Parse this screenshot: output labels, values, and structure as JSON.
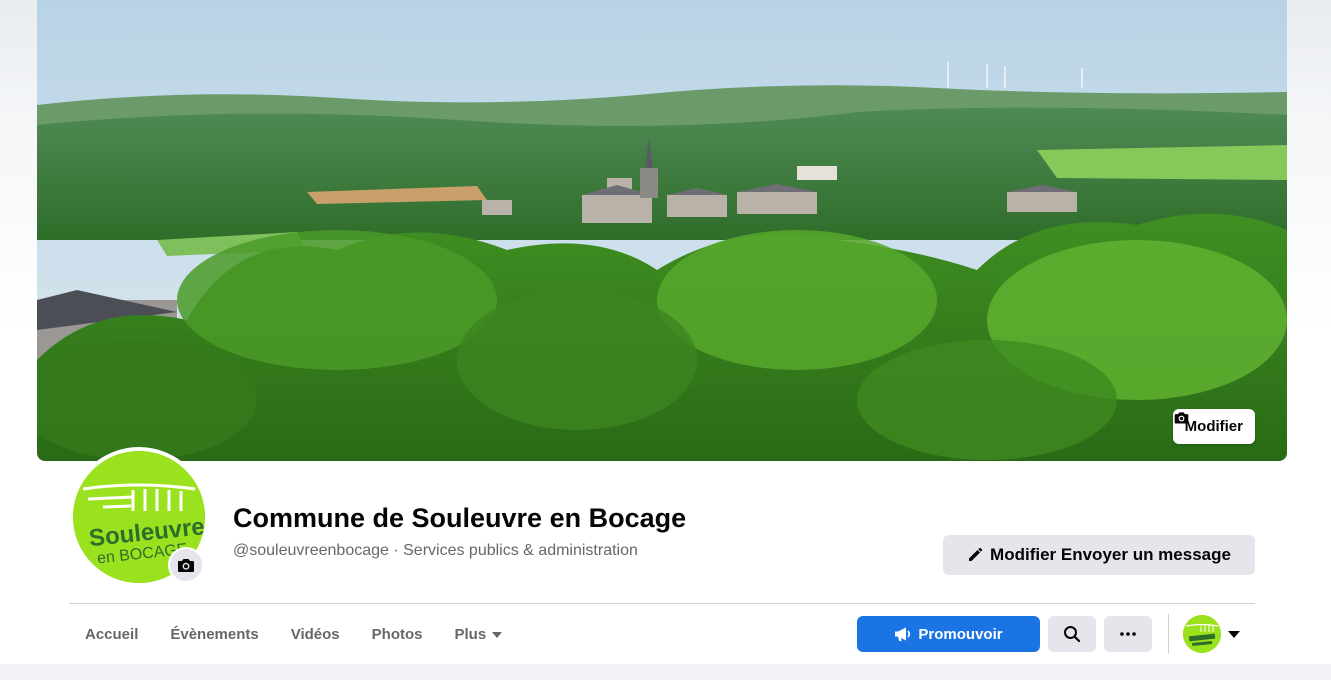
{
  "cover": {
    "edit_label": "Modifier",
    "edit_icon": "camera-icon"
  },
  "profile": {
    "logo_line1": "Souleuvre",
    "logo_line2": "en BOCAGE",
    "brand_color": "#9be21e",
    "camera_icon": "camera-icon"
  },
  "page": {
    "title": "Commune de Souleuvre en Bocage",
    "subtitle": "@souleuvreenbocage · Services publics & administration"
  },
  "actions": {
    "edit_message_label": "Modifier Envoyer un message",
    "edit_message_icon": "pencil-icon"
  },
  "nav": {
    "tabs": [
      {
        "label": "Accueil"
      },
      {
        "label": "Évènements"
      },
      {
        "label": "Vidéos"
      },
      {
        "label": "Photos"
      },
      {
        "label": "Plus",
        "has_caret": true
      }
    ]
  },
  "toolbar": {
    "promote_label": "Promouvoir",
    "promote_icon": "megaphone-icon",
    "promote_color": "#1b74e4",
    "search_icon": "search-icon",
    "more_icon": "more-icon"
  },
  "colors": {
    "text_primary": "#050505",
    "text_secondary": "#65676b",
    "button_gray": "#e4e6eb"
  }
}
